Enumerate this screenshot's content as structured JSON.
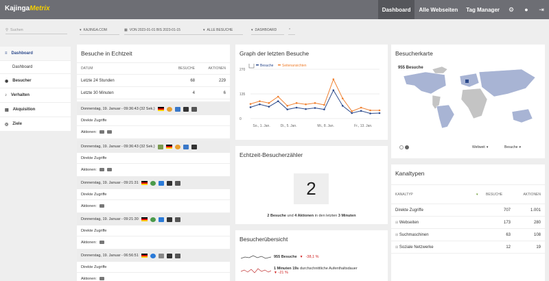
{
  "header": {
    "logo_text_1": "Kajinga",
    "logo_text_2": "Metrix",
    "nav": [
      {
        "label": "Dashboard"
      },
      {
        "label": "Alle Webseiten"
      },
      {
        "label": "Tag Manager"
      }
    ]
  },
  "filters": {
    "search_placeholder": "Suchen",
    "site": "KAJINGA.COM",
    "date_range": "VON 2023-01-01 BIS 2023-01-15",
    "segment": "ALLE BESUCHE",
    "dashboard": "DASHBOARD"
  },
  "sidebar": {
    "items": [
      {
        "label": "Dashboard"
      },
      {
        "label": "Dashboard"
      },
      {
        "label": "Besucher"
      },
      {
        "label": "Verhalten"
      },
      {
        "label": "Akquisition"
      },
      {
        "label": "Ziele"
      }
    ]
  },
  "realtime": {
    "title": "Besuche in Echtzeit",
    "headers": [
      "DATUM",
      "BESUCHE",
      "AKTIONEN"
    ],
    "rows": [
      [
        "Letzte 24 Stunden",
        "68",
        "229"
      ],
      [
        "Letzte 30 Minuten",
        "4",
        "6"
      ]
    ],
    "visits": [
      {
        "time": "Donnerstag, 19. Januar - 09:36:43 (32 Sek.)",
        "ref": "Direkte Zugriffe",
        "actions": "Aktionen:"
      },
      {
        "time": "Donnerstag, 19. Januar - 09:36:43 (32 Sek.)",
        "ref": "Direkte Zugriffe",
        "actions": "Aktionen:"
      },
      {
        "time": "Donnerstag, 19. Januar - 09:21:31",
        "ref": "Direkte Zugriffe",
        "actions": "Aktionen:"
      },
      {
        "time": "Donnerstag, 19. Januar - 09:21:30",
        "ref": "Direkte Zugriffe",
        "actions": "Aktionen:"
      },
      {
        "time": "Donnerstag, 19. Januar - 06:56:51",
        "ref": "Direkte Zugriffe",
        "actions": "Aktionen:"
      }
    ]
  },
  "graph": {
    "title": "Graph der letzten Besuche",
    "legend": [
      "Besuche",
      "Seitenansichten"
    ]
  },
  "chart_data": {
    "type": "line",
    "x": [
      "Sa., 1. Jan.",
      "So., 2. Jan.",
      "Mo., 3. Jan.",
      "Di., 4. Jan.",
      "Mi., 5. Jan.",
      "Do., 6. Jan.",
      "Fr., 7. Jan.",
      "Sa., 8. Jan.",
      "So., 9. Jan.",
      "Mo., 10. Jan.",
      "Di., 11. Jan.",
      "Mi., 12. Jan.",
      "Do., 13. Jan.",
      "Fr., 14. Jan.",
      "Sa., 15. Jan."
    ],
    "tick_labels": [
      "So., 1. Jan.",
      "Di., 5. Jan.",
      "Mi., 8. Jan.",
      "Fr., 13. Jan."
    ],
    "yticks": [
      "270",
      "135",
      "0"
    ],
    "ylim": [
      0,
      270
    ],
    "series": [
      {
        "name": "Besuche",
        "color": "#2c4a8c",
        "values": [
          62,
          78,
          65,
          95,
          50,
          60,
          52,
          58,
          50,
          155,
          70,
          30,
          42,
          28,
          30
        ]
      },
      {
        "name": "Seitenansichten",
        "color": "#f08030",
        "values": [
          80,
          95,
          85,
          120,
          70,
          85,
          78,
          85,
          75,
          215,
          110,
          40,
          60,
          45,
          45
        ]
      }
    ]
  },
  "counter": {
    "title": "Echtzeit-Besucherzähler",
    "value": "2",
    "line_a": "2 Besuche",
    "line_b": "und",
    "line_c": "4 Aktionen",
    "line_d": "in den letzten",
    "line_e": "3 Minuten"
  },
  "overview": {
    "title": "Besucherübersicht",
    "rows": [
      {
        "value": "955 Besuche",
        "change": "-38,1 %"
      },
      {
        "value": "1 Minuten 19s",
        "label": "durchschnittliche Aufenthaltsdauer",
        "change": "-21 %"
      }
    ]
  },
  "map": {
    "title": "Besucherkarte",
    "tooltip": "955 Besuche",
    "region": "Weltweit",
    "metric": "Besuche"
  },
  "channels": {
    "title": "Kanaltypen",
    "headers": [
      "KANALTYP",
      "BESUCHE",
      "AKTIONEN"
    ],
    "rows": [
      [
        "Direkte Zugriffe",
        "707",
        "1.001"
      ],
      [
        "Webseiten",
        "173",
        "280"
      ],
      [
        "Suchmaschinen",
        "63",
        "108"
      ],
      [
        "Soziale Netzwerke",
        "12",
        "19"
      ]
    ]
  },
  "colors": {
    "accent": "#2c4a8c",
    "orange": "#f08030",
    "topbar": "#6d6e74"
  }
}
